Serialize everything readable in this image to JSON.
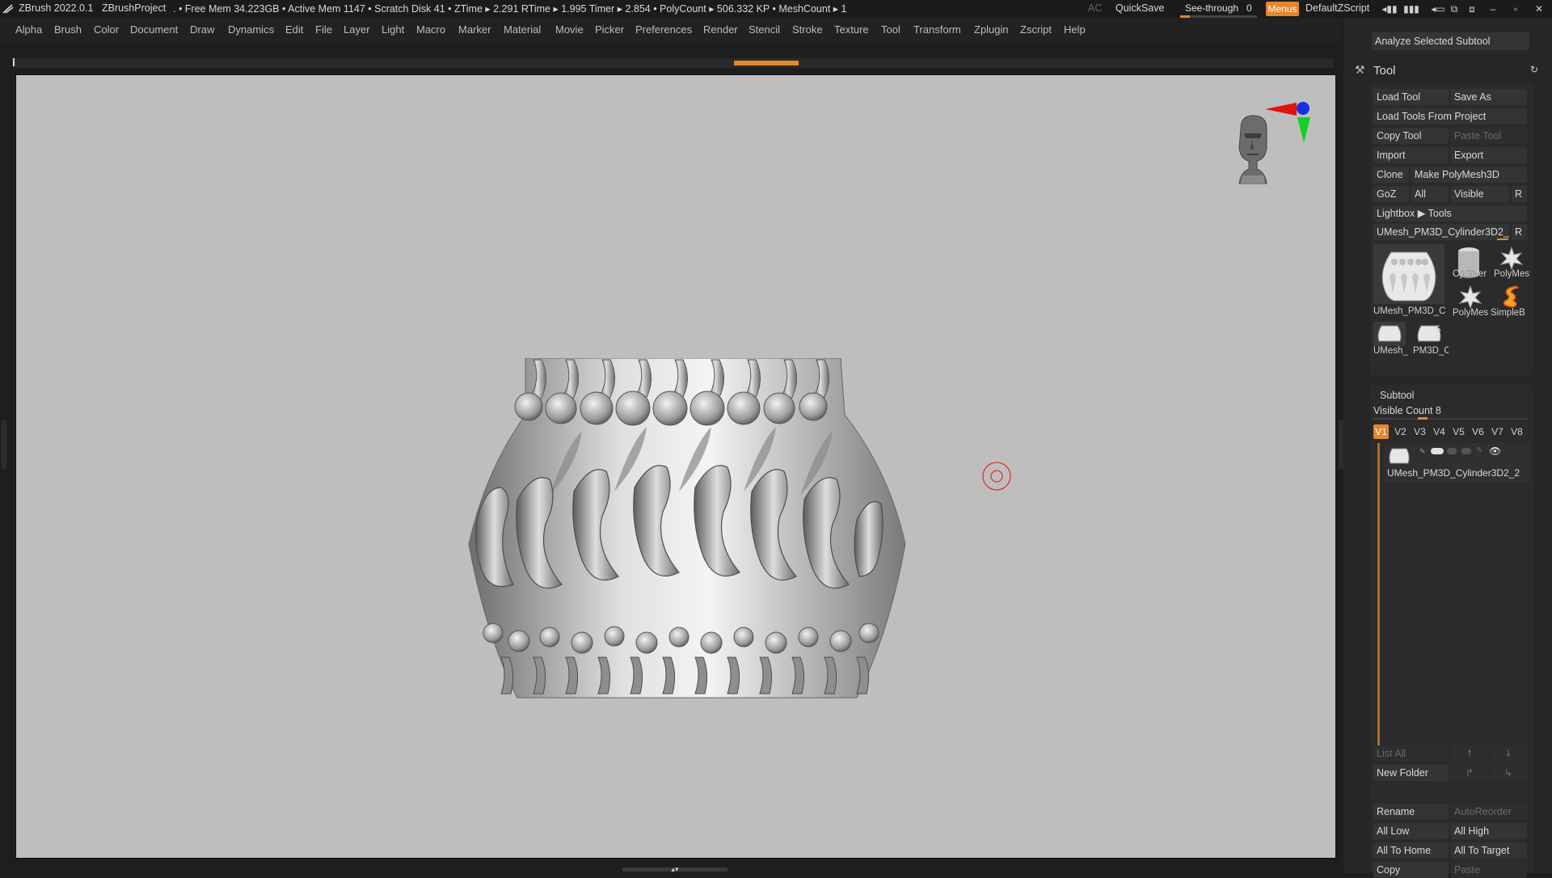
{
  "titlebar": {
    "app": "ZBrush 2022.0.1",
    "project": "ZBrushProject",
    "stats": ". • Free Mem 34.223GB • Active Mem 1147 • Scratch Disk 41 •  ZTime ▸ 2.291 RTime ▸ 1.995 Timer ▸ 2.854 • PolyCount ▸ 506.332 KP  • MeshCount ▸ 1",
    "ac": "AC",
    "quicksave": "QuickSave",
    "seethrough": "See-through   0",
    "menus": "Menus",
    "script": "DefaultZScript"
  },
  "menu": [
    "Alpha",
    "Brush",
    "Color",
    "Document",
    "Draw",
    "Dynamics",
    "Edit",
    "File",
    "Layer",
    "Light",
    "Macro",
    "Marker",
    "Material",
    "Movie",
    "Picker",
    "Preferences",
    "Render",
    "Stencil",
    "Stroke",
    "Texture",
    "Tool",
    "Transform",
    "Zplugin",
    "Zscript",
    "Help"
  ],
  "palette": {
    "analyze": "Analyze Selected Subtool",
    "title": "Tool",
    "load_tool": "Load Tool",
    "save_as": "Save As",
    "load_from_project": "Load Tools From Project",
    "copy_tool": "Copy Tool",
    "paste_tool": "Paste Tool",
    "import": "Import",
    "export": "Export",
    "clone": "Clone",
    "make_polymesh": "Make PolyMesh3D",
    "goz": "GoZ",
    "all": "All",
    "visible": "Visible",
    "r": "R",
    "lightbox": "Lightbox ▶ Tools",
    "current_tool": "UMesh_PM3D_Cylinder3D2_2",
    "thumbs": {
      "main": "UMesh_PM3D_C",
      "cylinder": "Cylinder",
      "polymesh1": "PolyMes",
      "polymesh2": "PolyMes",
      "simpleb": "SimpleB",
      "umesh_small": "UMesh_",
      "pm3d_small": "PM3D_C",
      "count": "5"
    }
  },
  "subtool": {
    "title": "Subtool",
    "visible_count": "Visible Count 8",
    "tabs": [
      "V1",
      "V2",
      "V3",
      "V4",
      "V5",
      "V6",
      "V7",
      "V8"
    ],
    "item": "UMesh_PM3D_Cylinder3D2_2",
    "list_all": "List All",
    "new_folder": "New Folder",
    "rename": "Rename",
    "autoreorder": "AutoReorder",
    "all_low": "All Low",
    "all_high": "All High",
    "all_to_home": "All To Home",
    "all_to_target": "All To Target",
    "copy": "Copy",
    "paste": "Paste"
  }
}
